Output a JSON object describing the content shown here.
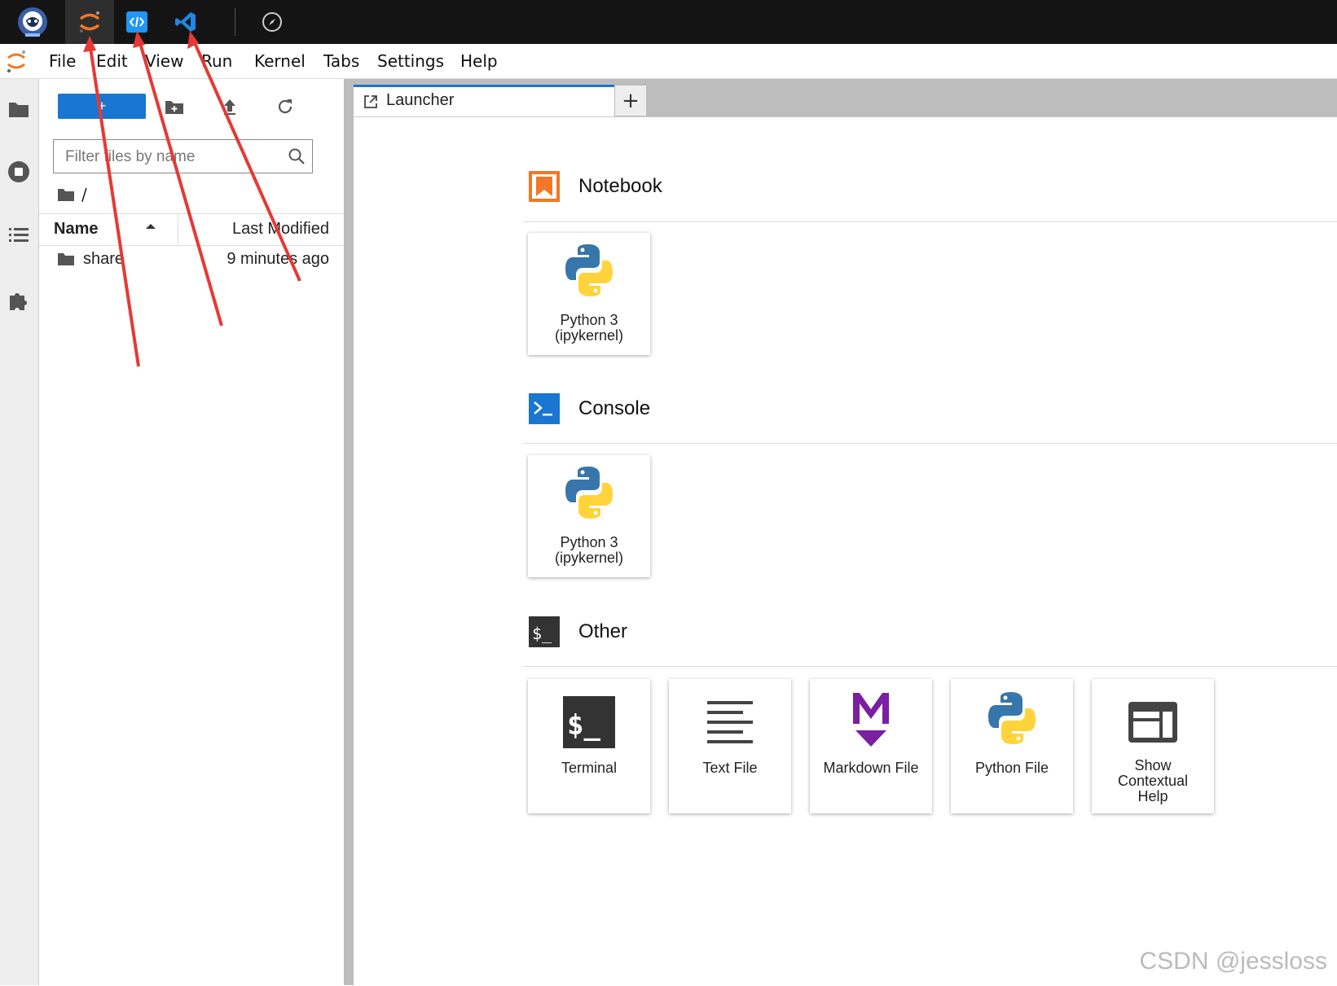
{
  "menubar": {
    "items": [
      "File",
      "Edit",
      "View",
      "Run",
      "Kernel",
      "Tabs",
      "Settings",
      "Help"
    ]
  },
  "filebrowser": {
    "new_label": "+",
    "filter_placeholder": "Filter files by name",
    "breadcrumb": "/",
    "columns": {
      "name": "Name",
      "modified": "Last Modified"
    },
    "files": [
      {
        "name": "share",
        "modified": "9 minutes ago"
      }
    ]
  },
  "tabs": {
    "launcher_label": "Launcher",
    "add_label": "+"
  },
  "launcher": {
    "notebook": {
      "title": "Notebook",
      "cards": [
        {
          "line1": "Python 3",
          "line2": "(ipykernel)"
        }
      ]
    },
    "console": {
      "title": "Console",
      "cards": [
        {
          "line1": "Python 3",
          "line2": "(ipykernel)"
        }
      ]
    },
    "other": {
      "title": "Other",
      "cards": [
        "Terminal",
        "Text File",
        "Markdown File",
        "Python File"
      ],
      "help_card": {
        "line1": "Show",
        "line2": "Contextual",
        "line3": "Help"
      }
    }
  },
  "watermark": "CSDN @jessloss",
  "colors": {
    "accent": "#1976d2",
    "jupyter_orange": "#f37726",
    "console_blue": "#1976d2",
    "markdown_purple": "#7b1fa2",
    "annotation_red": "#e53935"
  },
  "icons": {
    "topbar": [
      "astronaut-icon",
      "jupyter-icon",
      "code-server-icon",
      "vscode-icon",
      "compass-icon"
    ],
    "sidebar": [
      "folder-icon",
      "stop-icon",
      "list-icon",
      "puzzle-icon"
    ]
  }
}
